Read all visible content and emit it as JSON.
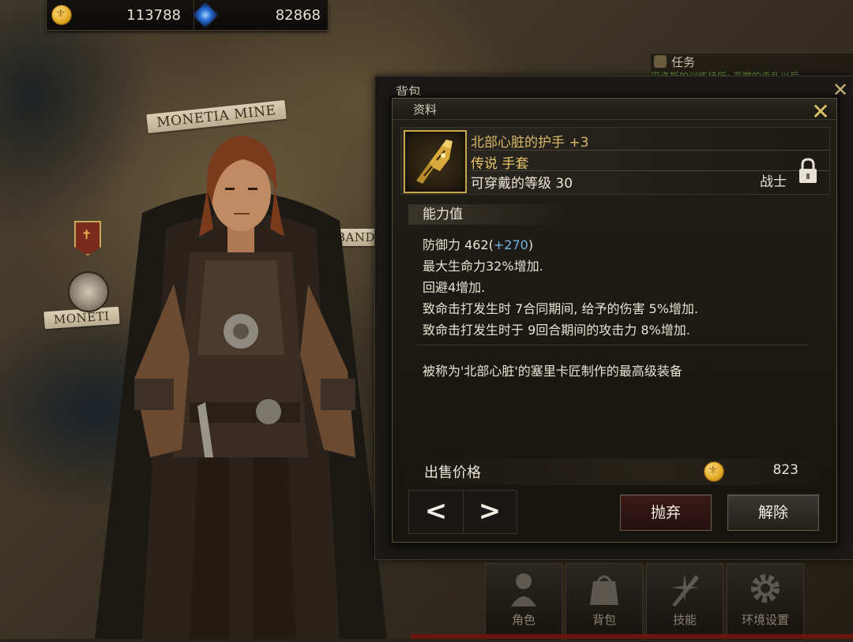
{
  "map": {
    "labels": [
      "MONETIA MINE",
      "MONETI",
      "BAND"
    ]
  },
  "currency": {
    "gold": {
      "icon": "gold-coin-icon",
      "value": "113788"
    },
    "gem": {
      "icon": "blue-gem-icon",
      "value": "82868"
    }
  },
  "quest": {
    "title": "任务",
    "subtitle": "巴洛斯的训练场所: 恶魔的幸乱以后"
  },
  "inventory": {
    "title": "背包"
  },
  "detail": {
    "title": "资料",
    "item": {
      "name": "北部心脏的护手",
      "upgrade": "+3",
      "rarity_type": "传说 手套",
      "level_req": "可穿戴的等级 30",
      "class": "战士",
      "thumbnail_icon": "gauntlet-icon"
    },
    "stats_heading": "能力值",
    "stats": {
      "defense_label": "防御力 462(",
      "defense_bonus": "+270",
      "defense_close": ")",
      "line2": "最大生命力32%增加.",
      "line3": "回避4增加.",
      "line4": "致命击打发生时 7合同期间, 给予的伤害 5%增加.",
      "line5": "致命击打发生时于 9回合期间的攻击力 8%增加."
    },
    "description": "被称为'北部心脏'的塞里卡匠制作的最高级装备",
    "price_label": "出售价格",
    "price_value": "823",
    "buttons": {
      "prev": "<",
      "next": ">",
      "discard": "抛弃",
      "dismantle": "解除"
    }
  },
  "bottom_menu": [
    {
      "label": "角色",
      "icon": "character-icon"
    },
    {
      "label": "背包",
      "icon": "bag-icon"
    },
    {
      "label": "技能",
      "icon": "skill-icon"
    },
    {
      "label": "环境设置",
      "icon": "settings-gear-icon"
    }
  ],
  "colors": {
    "legendary": "#e7c56a",
    "bonus_blue": "#6fb4e6",
    "discard_red": "#3a1a17"
  }
}
